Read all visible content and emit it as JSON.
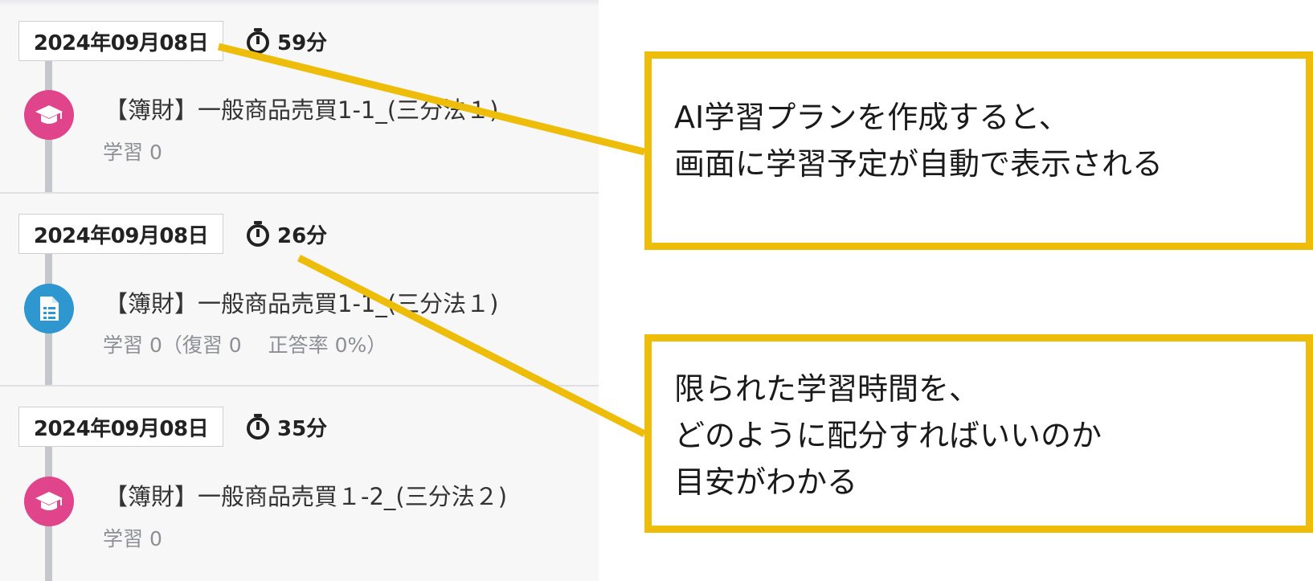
{
  "timeline": {
    "items": [
      {
        "date": "2024年09月08日",
        "duration": "59分",
        "icon": "graduation-cap-icon",
        "icon_color": "#e0448b",
        "title": "【簿財】一般商品売買1-1_(三分法１)",
        "meta": "学習 0"
      },
      {
        "date": "2024年09月08日",
        "duration": "26分",
        "icon": "document-icon",
        "icon_color": "#2e97cf",
        "title": "【簿財】一般商品売買1-1_(三分法１)",
        "meta": "学習 0（復習 0　 正答率 0%）"
      },
      {
        "date": "2024年09月08日",
        "duration": "35分",
        "icon": "graduation-cap-icon",
        "icon_color": "#e0448b",
        "title": "【簿財】一般商品売買１-2_(三分法２)",
        "meta": "学習 0"
      }
    ]
  },
  "callouts": [
    {
      "lines": [
        "AI学習プランを作成すると、",
        "画面に学習予定が自動で表示される"
      ]
    },
    {
      "lines": [
        "限られた学習時間を、",
        "どのように配分すればいいのか",
        "目安がわかる"
      ]
    }
  ],
  "colors": {
    "accent": "#eebd0a",
    "panel_bg": "#f7f7f8",
    "timeline_line": "#c6c7cc"
  }
}
